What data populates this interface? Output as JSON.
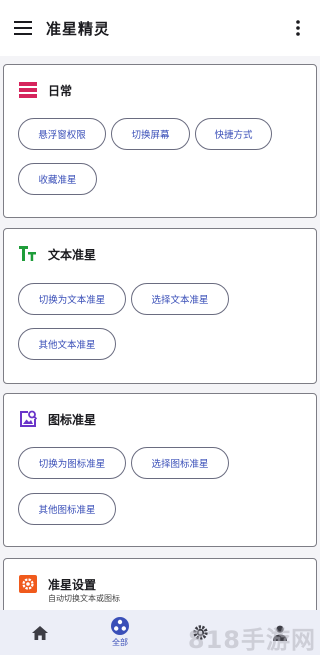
{
  "app": {
    "title": "准星精灵"
  },
  "icons": {
    "menu": "hamburger-menu-icon",
    "overflow": "more-vert-icon",
    "daily": "layers-icon",
    "text": "text-icon",
    "image": "image-search-icon",
    "settings": "settings-badge-icon",
    "home": "home-icon",
    "apps": "apps-circle-icon",
    "gear": "gear-icon",
    "person": "person-icon"
  },
  "colors": {
    "accent": "#3a4fb8",
    "daily_icon": "#d6245c",
    "text_icon": "#1f9d3a",
    "image_icon": "#6a35c9",
    "settings_icon": "#f05a1c",
    "nav_bg": "#eceef7"
  },
  "cards": {
    "daily": {
      "title": "日常",
      "chips": [
        "悬浮窗权限",
        "切换屏幕",
        "快捷方式",
        "收藏准星"
      ]
    },
    "text": {
      "title": "文本准星",
      "chips": [
        "切换为文本准星",
        "选择文本准星",
        "其他文本准星"
      ]
    },
    "image": {
      "title": "图标准星",
      "chips": [
        "切换为图标准星",
        "选择图标准星",
        "其他图标准星"
      ]
    },
    "settings": {
      "title": "准星设置",
      "subtitle": "自动切换文本或图标"
    }
  },
  "nav": {
    "items": [
      {
        "name": "home",
        "label": ""
      },
      {
        "name": "apps",
        "label": "全部"
      },
      {
        "name": "settings",
        "label": ""
      },
      {
        "name": "profile",
        "label": ""
      }
    ]
  },
  "watermark": "818手游网"
}
